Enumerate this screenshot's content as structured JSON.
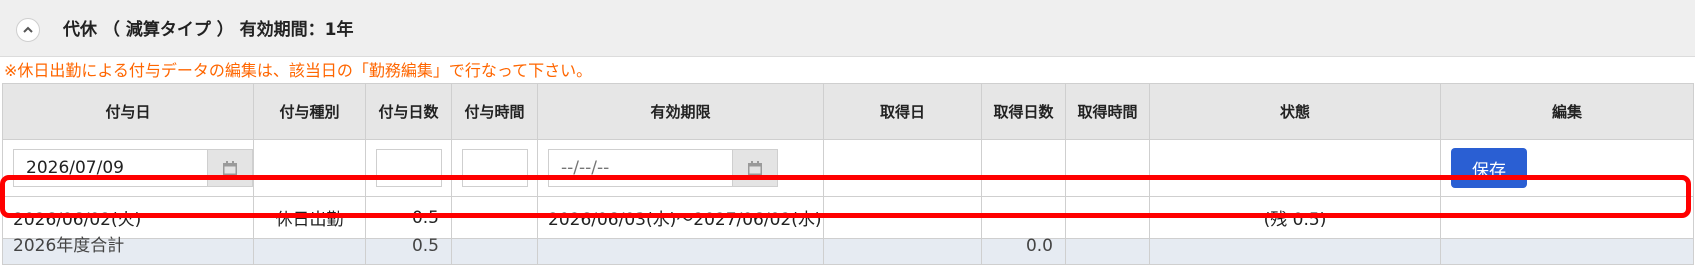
{
  "panel": {
    "title": "代休 （ 減算タイプ ） 有効期間：1年",
    "notice": "※休日出勤による付与データの編集は、該当日の「勤務編集」で行なって下さい。"
  },
  "table": {
    "headers": [
      "付与日",
      "付与種別",
      "付与日数",
      "付与時間",
      "有効期限",
      "取得日",
      "取得日数",
      "取得時間",
      "状態",
      "編集"
    ],
    "entry": {
      "grant_date_value": "2026/07/09",
      "expiry_placeholder": "--/--/--",
      "save_label": "保存"
    },
    "row": {
      "grant_date": "2026/06/02(火)",
      "grant_type": "休日出勤",
      "grant_days": "0.5",
      "grant_time": "",
      "expiry": "2026/06/03(水)～2027/06/02(水)",
      "taken_date": "",
      "taken_days": "",
      "taken_time": "",
      "status": "(残 0.5)",
      "edit": ""
    },
    "total": {
      "label": "2026年度合計",
      "grant_days": "0.5",
      "taken_days": "0.0"
    }
  },
  "colors": {
    "highlight": "#ff0000",
    "notice": "#ff6600",
    "save_button": "#2a5fd3"
  }
}
